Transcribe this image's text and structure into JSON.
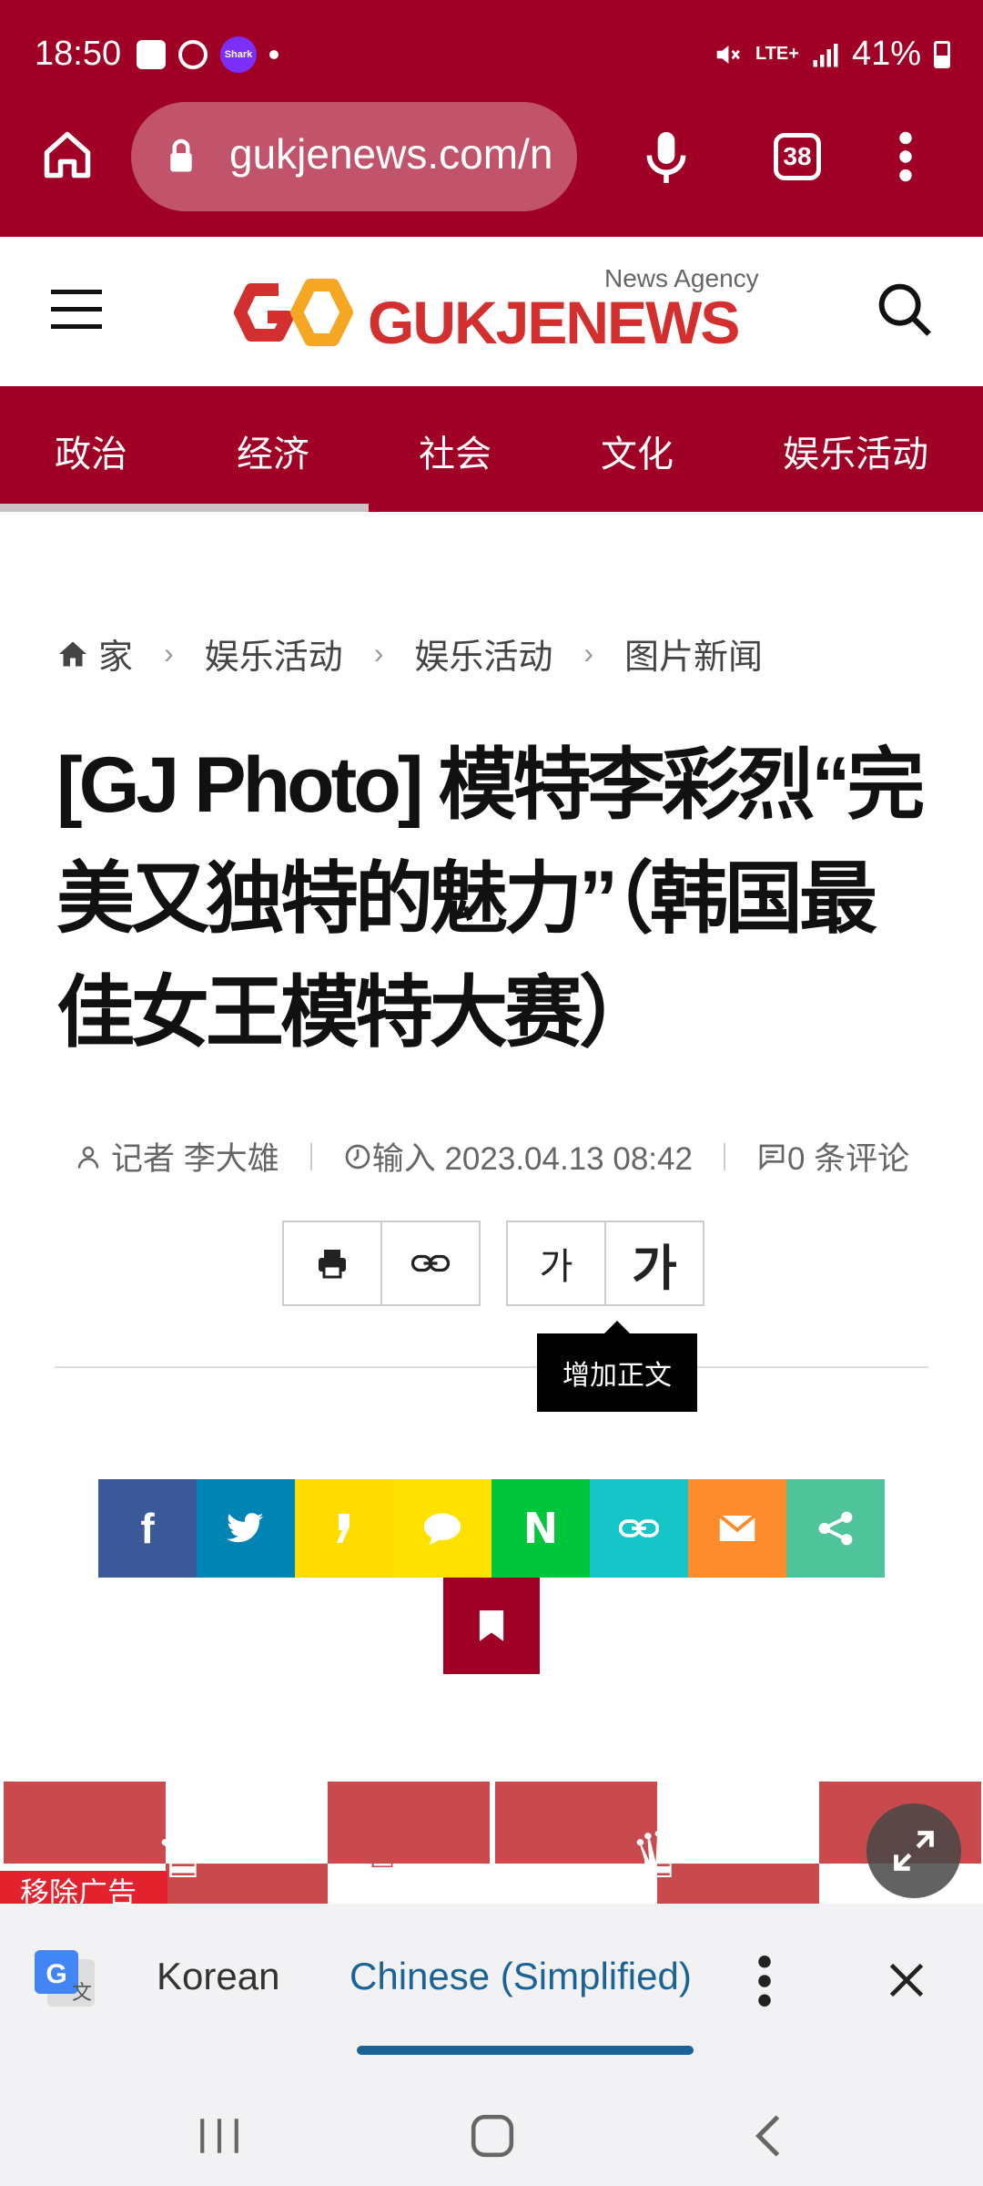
{
  "status_bar": {
    "time": "18:50",
    "notification_badge": "Shark",
    "network": "LTE+",
    "battery": "41%"
  },
  "browser": {
    "url": "gukjenews.com/n",
    "tab_count": "38"
  },
  "site": {
    "logo_tagline": "News Agency",
    "logo_text": "GUKJENEWS",
    "brand_color": "#a10026"
  },
  "categories": [
    {
      "label": "政治"
    },
    {
      "label": "经济"
    },
    {
      "label": "社会"
    },
    {
      "label": "文化"
    },
    {
      "label": "娱乐活动"
    }
  ],
  "breadcrumb": {
    "home": "家",
    "items": [
      "娱乐活动",
      "娱乐活动",
      "图片新闻"
    ]
  },
  "article": {
    "title": "[GJ Photo] 模特李彩烈“完美又独特的魅力”（韩国最佳女王模特大赛）",
    "reporter": "记者 李大雄",
    "input_date": "输入 2023.04.13 08:42",
    "comments": "0 条评论"
  },
  "tools": {
    "font_small": "가",
    "font_large": "가",
    "tooltip": "增加正文"
  },
  "share_buttons": [
    {
      "name": "facebook",
      "color": "#3b5998"
    },
    {
      "name": "twitter",
      "color": "#0084b4"
    },
    {
      "name": "kakaostory",
      "color": "#ffdc00"
    },
    {
      "name": "kakaotalk",
      "color": "#ffe100"
    },
    {
      "name": "naver",
      "color": "#00c63b"
    },
    {
      "name": "copy-link",
      "color": "#16c5c8"
    },
    {
      "name": "email",
      "color": "#ff8b2b"
    },
    {
      "name": "share",
      "color": "#4fc49b"
    }
  ],
  "ad": {
    "remove_label": "移除广告"
  },
  "translate_bar": {
    "source_lang": "Korean",
    "target_lang": "Chinese (Simplified)",
    "active_color": "#1a6394"
  }
}
